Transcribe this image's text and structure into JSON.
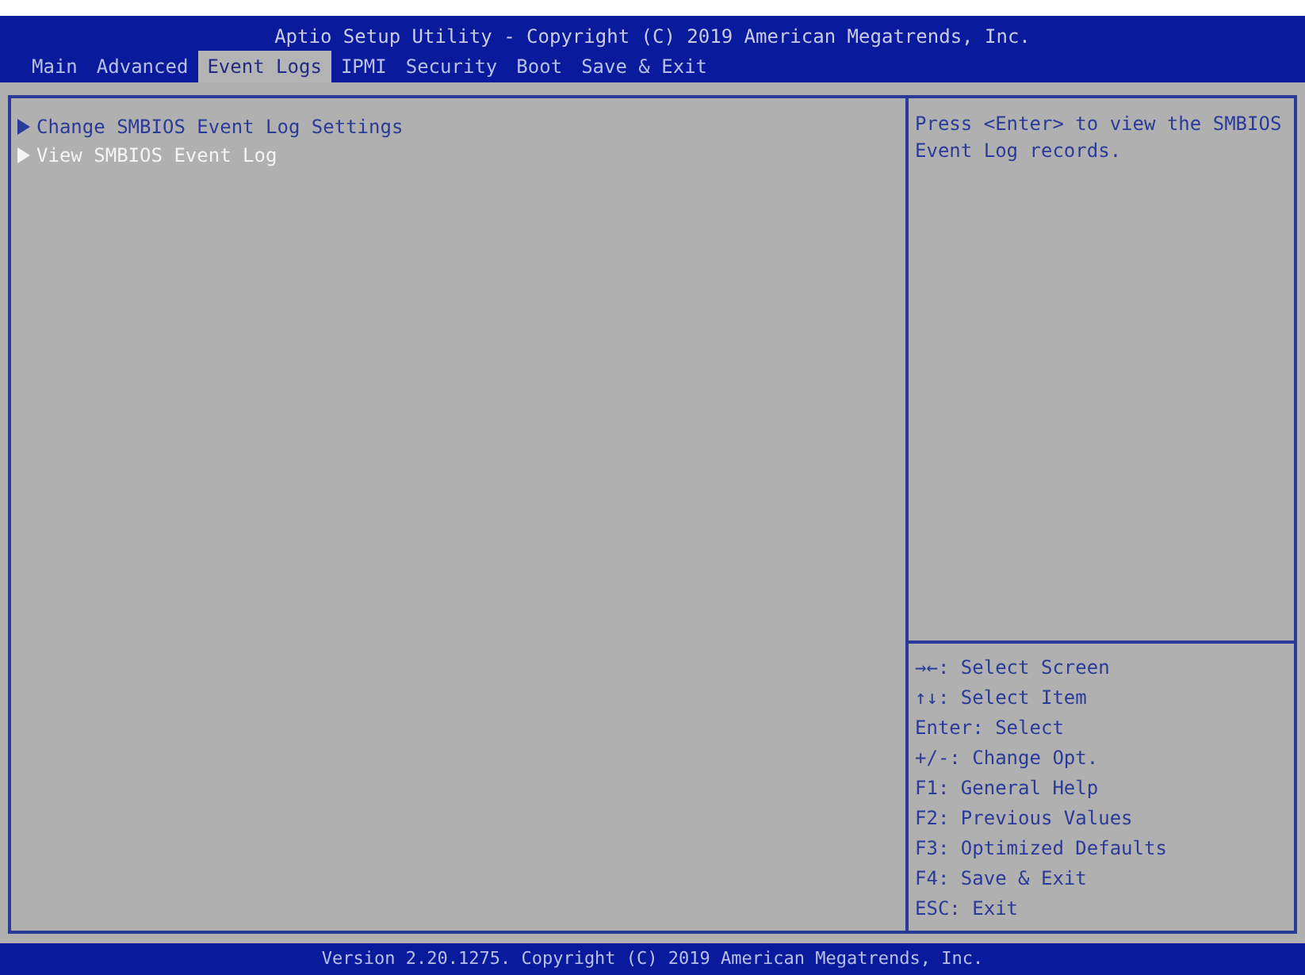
{
  "window": {
    "title": "Aptio Setup Utility - Copyright (C) 2019 American Megatrends, Inc."
  },
  "tabs": [
    {
      "label": "Main",
      "selected": false
    },
    {
      "label": "Advanced",
      "selected": false
    },
    {
      "label": "Event Logs",
      "selected": true
    },
    {
      "label": "IPMI",
      "selected": false
    },
    {
      "label": "Security",
      "selected": false
    },
    {
      "label": "Boot",
      "selected": false
    },
    {
      "label": "Save & Exit",
      "selected": false
    }
  ],
  "menu_items": [
    {
      "label": "Change SMBIOS Event Log Settings",
      "selected": false
    },
    {
      "label": "View SMBIOS Event Log",
      "selected": true
    }
  ],
  "help_text": "Press <Enter> to view the SMBIOS Event Log records.",
  "key_help": [
    "→←: Select Screen",
    "↑↓: Select Item",
    "Enter: Select",
    "+/-: Change Opt.",
    "F1: General Help",
    "F2: Previous Values",
    "F3: Optimized Defaults",
    "F4: Save & Exit",
    "ESC: Exit"
  ],
  "status_bar": "Version 2.20.1275. Copyright (C) 2019 American Megatrends, Inc."
}
